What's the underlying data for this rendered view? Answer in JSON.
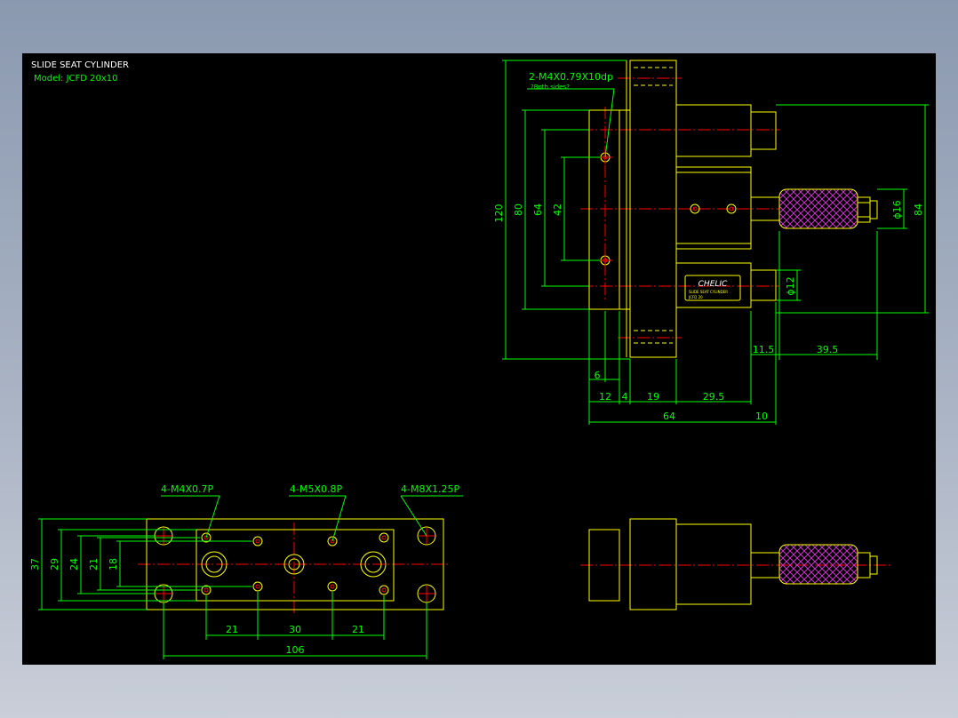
{
  "sheet": {
    "title": "SLIDE SEAT CYLINDER",
    "model": "Model:  JCFD 20x10"
  },
  "colors": {
    "background": "#000000",
    "outline": "#ffff00",
    "dimension": "#00ff00",
    "centerline": "#ff0000",
    "title_text": "#ffffff",
    "knurl": "#cc33cc"
  },
  "side_view": {
    "callout": "2-M4X0.79X10dp",
    "callout_note": "?Both sides?",
    "dims": {
      "d120": "120",
      "d80": "80",
      "d64v": "64",
      "d42": "42",
      "d84": "84",
      "dia16": "ϕ16",
      "dia12": "ϕ12",
      "d6": "6",
      "d12": "12",
      "d4": "4",
      "d19": "19",
      "d29_5": "29.5",
      "d11_5": "11.5",
      "d39_5": "39.5",
      "d64h": "64",
      "d10": "10"
    },
    "brand": "CHELIC",
    "plate_line1": "SLIDE SEAT CYLINDER",
    "plate_line2": "JCFD 20"
  },
  "bottom_view": {
    "callout1": "4-M4X0.7P",
    "callout2": "4-M5X0.8P",
    "callout3": "4-M8X1.25P",
    "dims": {
      "d37": "37",
      "d29": "29",
      "d24": "24",
      "d21v": "21",
      "d18": "18",
      "d21a": "21",
      "d30": "30",
      "d21b": "21",
      "d106": "106"
    }
  }
}
